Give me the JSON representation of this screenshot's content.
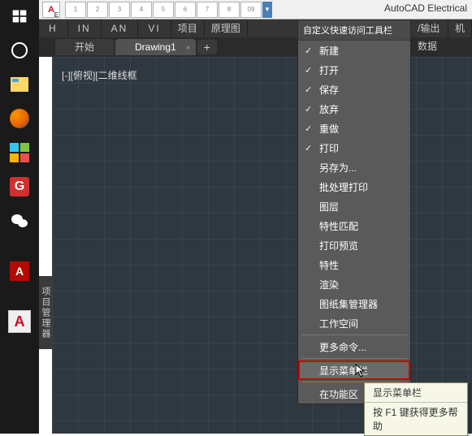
{
  "app_title": "AutoCAD Electrical",
  "qat": [
    "1",
    "2",
    "3",
    "4",
    "5",
    "6",
    "7",
    "8",
    "09"
  ],
  "ribbon_tabs": [
    "H",
    "IN",
    "AN",
    "VI",
    "项目",
    "原理图",
    "/输出数据",
    "机"
  ],
  "file_tabs": {
    "start": "开始",
    "drawing": "Drawing1"
  },
  "view_label": "[-][俯视][二维线框",
  "sidebar_label": "项目管理器",
  "menu": {
    "title": "自定义快速访问工具栏",
    "items_checked": [
      "新建",
      "打开",
      "保存",
      "放弃",
      "重做",
      "打印"
    ],
    "items_unchecked": [
      "另存为...",
      "批处理打印",
      "图层",
      "特性匹配",
      "打印预览",
      "特性",
      "渲染",
      "图纸集管理器",
      "工作空间"
    ],
    "more": "更多命令...",
    "showmenu": "显示菜单栏",
    "below": "在功能区"
  },
  "tooltip": {
    "title": "显示菜单栏",
    "help": "按 F1 键获得更多帮助"
  }
}
